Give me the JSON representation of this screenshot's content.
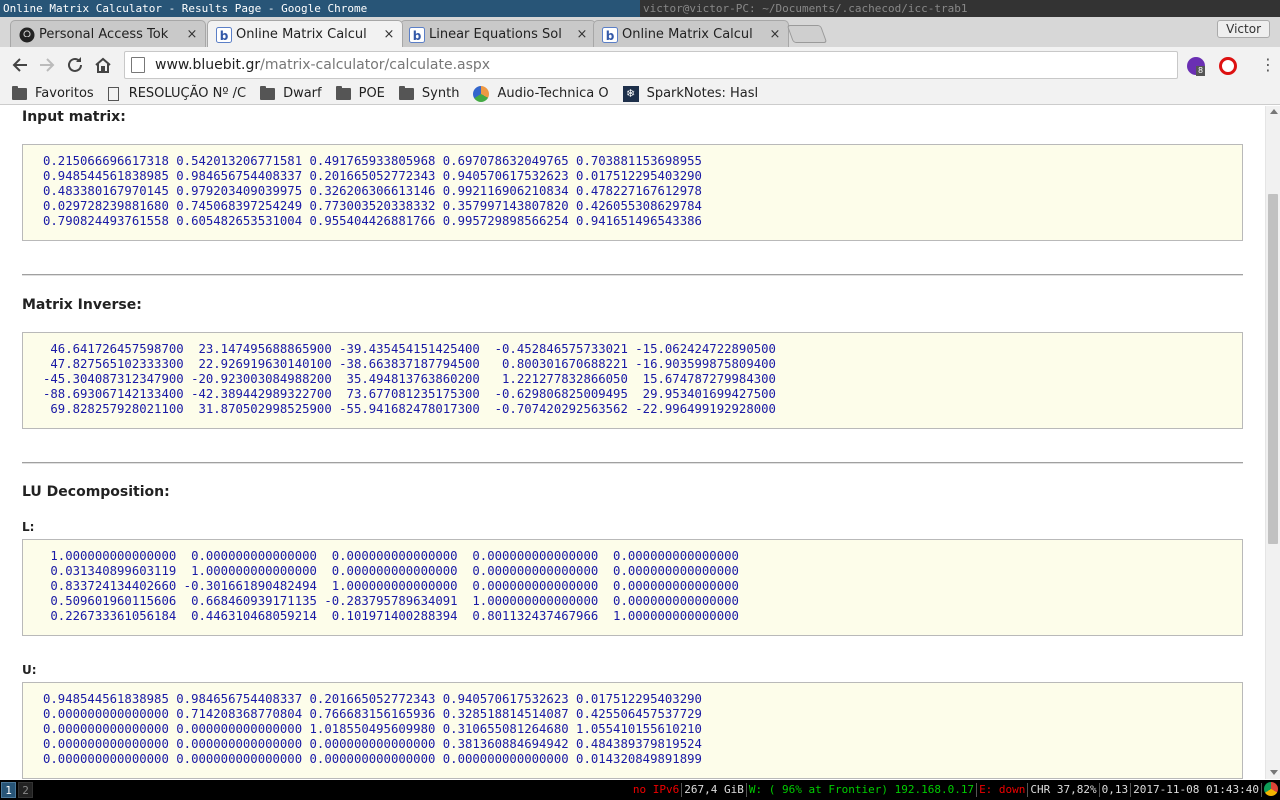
{
  "os": {
    "window_title": "Online Matrix Calculator - Results Page - Google Chrome",
    "terminal_title": "victor@victor-PC: ~/Documents/.cachecod/icc-trab1",
    "workspaces": [
      "1",
      "2"
    ],
    "status": {
      "ipv6": "no IPv6",
      "disk": "267,4 GiB",
      "wifi": "W: ( 96% at Frontier) 192.168.0.17",
      "eth": "E: down",
      "battery": "CHR 37,82%",
      "load": "0,13",
      "datetime": "2017-11-08 01:43:40"
    }
  },
  "browser": {
    "profile_name": "Victor",
    "tabs": [
      {
        "title": "Personal Access Tok",
        "icon": "github-icon",
        "active": false
      },
      {
        "title": "Online Matrix Calcul",
        "icon": "bluebit-icon",
        "active": true
      },
      {
        "title": "Linear Equations Sol",
        "icon": "bluebit-icon",
        "active": false
      },
      {
        "title": "Online Matrix Calcul",
        "icon": "bluebit-icon",
        "active": false
      }
    ],
    "close_glyph": "×",
    "url_host": "www.bluebit.gr",
    "url_path": "/matrix-calculator/calculate.aspx",
    "extension_badge": "8",
    "bookmarks": [
      {
        "label": "Favoritos",
        "icon": "folder"
      },
      {
        "label": "RESOLUÇÃO Nº /C",
        "icon": "doc"
      },
      {
        "label": "Dwarf",
        "icon": "folder"
      },
      {
        "label": "POE",
        "icon": "folder"
      },
      {
        "label": "Synth",
        "icon": "folder"
      },
      {
        "label": "Audio-Technica O",
        "icon": "circle"
      },
      {
        "label": "SparkNotes: Hasl",
        "icon": "snow"
      }
    ]
  },
  "page": {
    "input_heading": "Input matrix:",
    "input_rows": [
      "0.215066696617318 0.542013206771581 0.491765933805968 0.697078632049765 0.703881153698955",
      "0.948544561838985 0.984656754408337 0.201665052772343 0.940570617532623 0.017512295403290",
      "0.483380167970145 0.979203409039975 0.326206306613146 0.992116906210834 0.478227167612978",
      "0.029728239881680 0.745068397254249 0.773003520338332 0.357997143807820 0.426055308629784",
      "0.790824493761558 0.605482653531004 0.955404426881766 0.995729898566254 0.941651496543386"
    ],
    "inverse_heading": "Matrix Inverse:",
    "inverse_rows": [
      " 46.641726457598700  23.147495688865900 -39.435454151425400  -0.452846575733021 -15.062424722890500",
      " 47.827565102333300  22.926919630140100 -38.663837187794500   0.800301670688221 -16.903599875809400",
      "-45.304087312347900 -20.923003084988200  35.494813763860200   1.221277832866050  15.674787279984300",
      "-88.693067142133400 -42.389442989322700  73.677081235175300  -0.629806825009495  29.953401699427500",
      " 69.828257928021100  31.870502998525900 -55.941682478017300  -0.707420292563562 -22.996499192928000"
    ],
    "lu_heading": "LU Decomposition:",
    "l_label": "L:",
    "l_rows": [
      " 1.000000000000000  0.000000000000000  0.000000000000000  0.000000000000000  0.000000000000000",
      " 0.031340899603119  1.000000000000000  0.000000000000000  0.000000000000000  0.000000000000000",
      " 0.833724134402660 -0.301661890482494  1.000000000000000  0.000000000000000  0.000000000000000",
      " 0.509601960115606  0.668460939171135 -0.283795789634091  1.000000000000000  0.000000000000000",
      " 0.226733361056184  0.446310468059214  0.101971400288394  0.801132437467966  1.000000000000000"
    ],
    "u_label": "U:",
    "u_rows": [
      "0.948544561838985 0.984656754408337 0.201665052772343 0.940570617532623 0.017512295403290",
      "0.000000000000000 0.714208368770804 0.766683156165936 0.328518814514087 0.425506457537729",
      "0.000000000000000 0.000000000000000 1.018550495609980 0.310655081264680 1.055410155610210",
      "0.000000000000000 0.000000000000000 0.000000000000000 0.381360884694942 0.484389379819524",
      "0.000000000000000 0.000000000000000 0.000000000000000 0.000000000000000 0.014320849891899"
    ]
  }
}
